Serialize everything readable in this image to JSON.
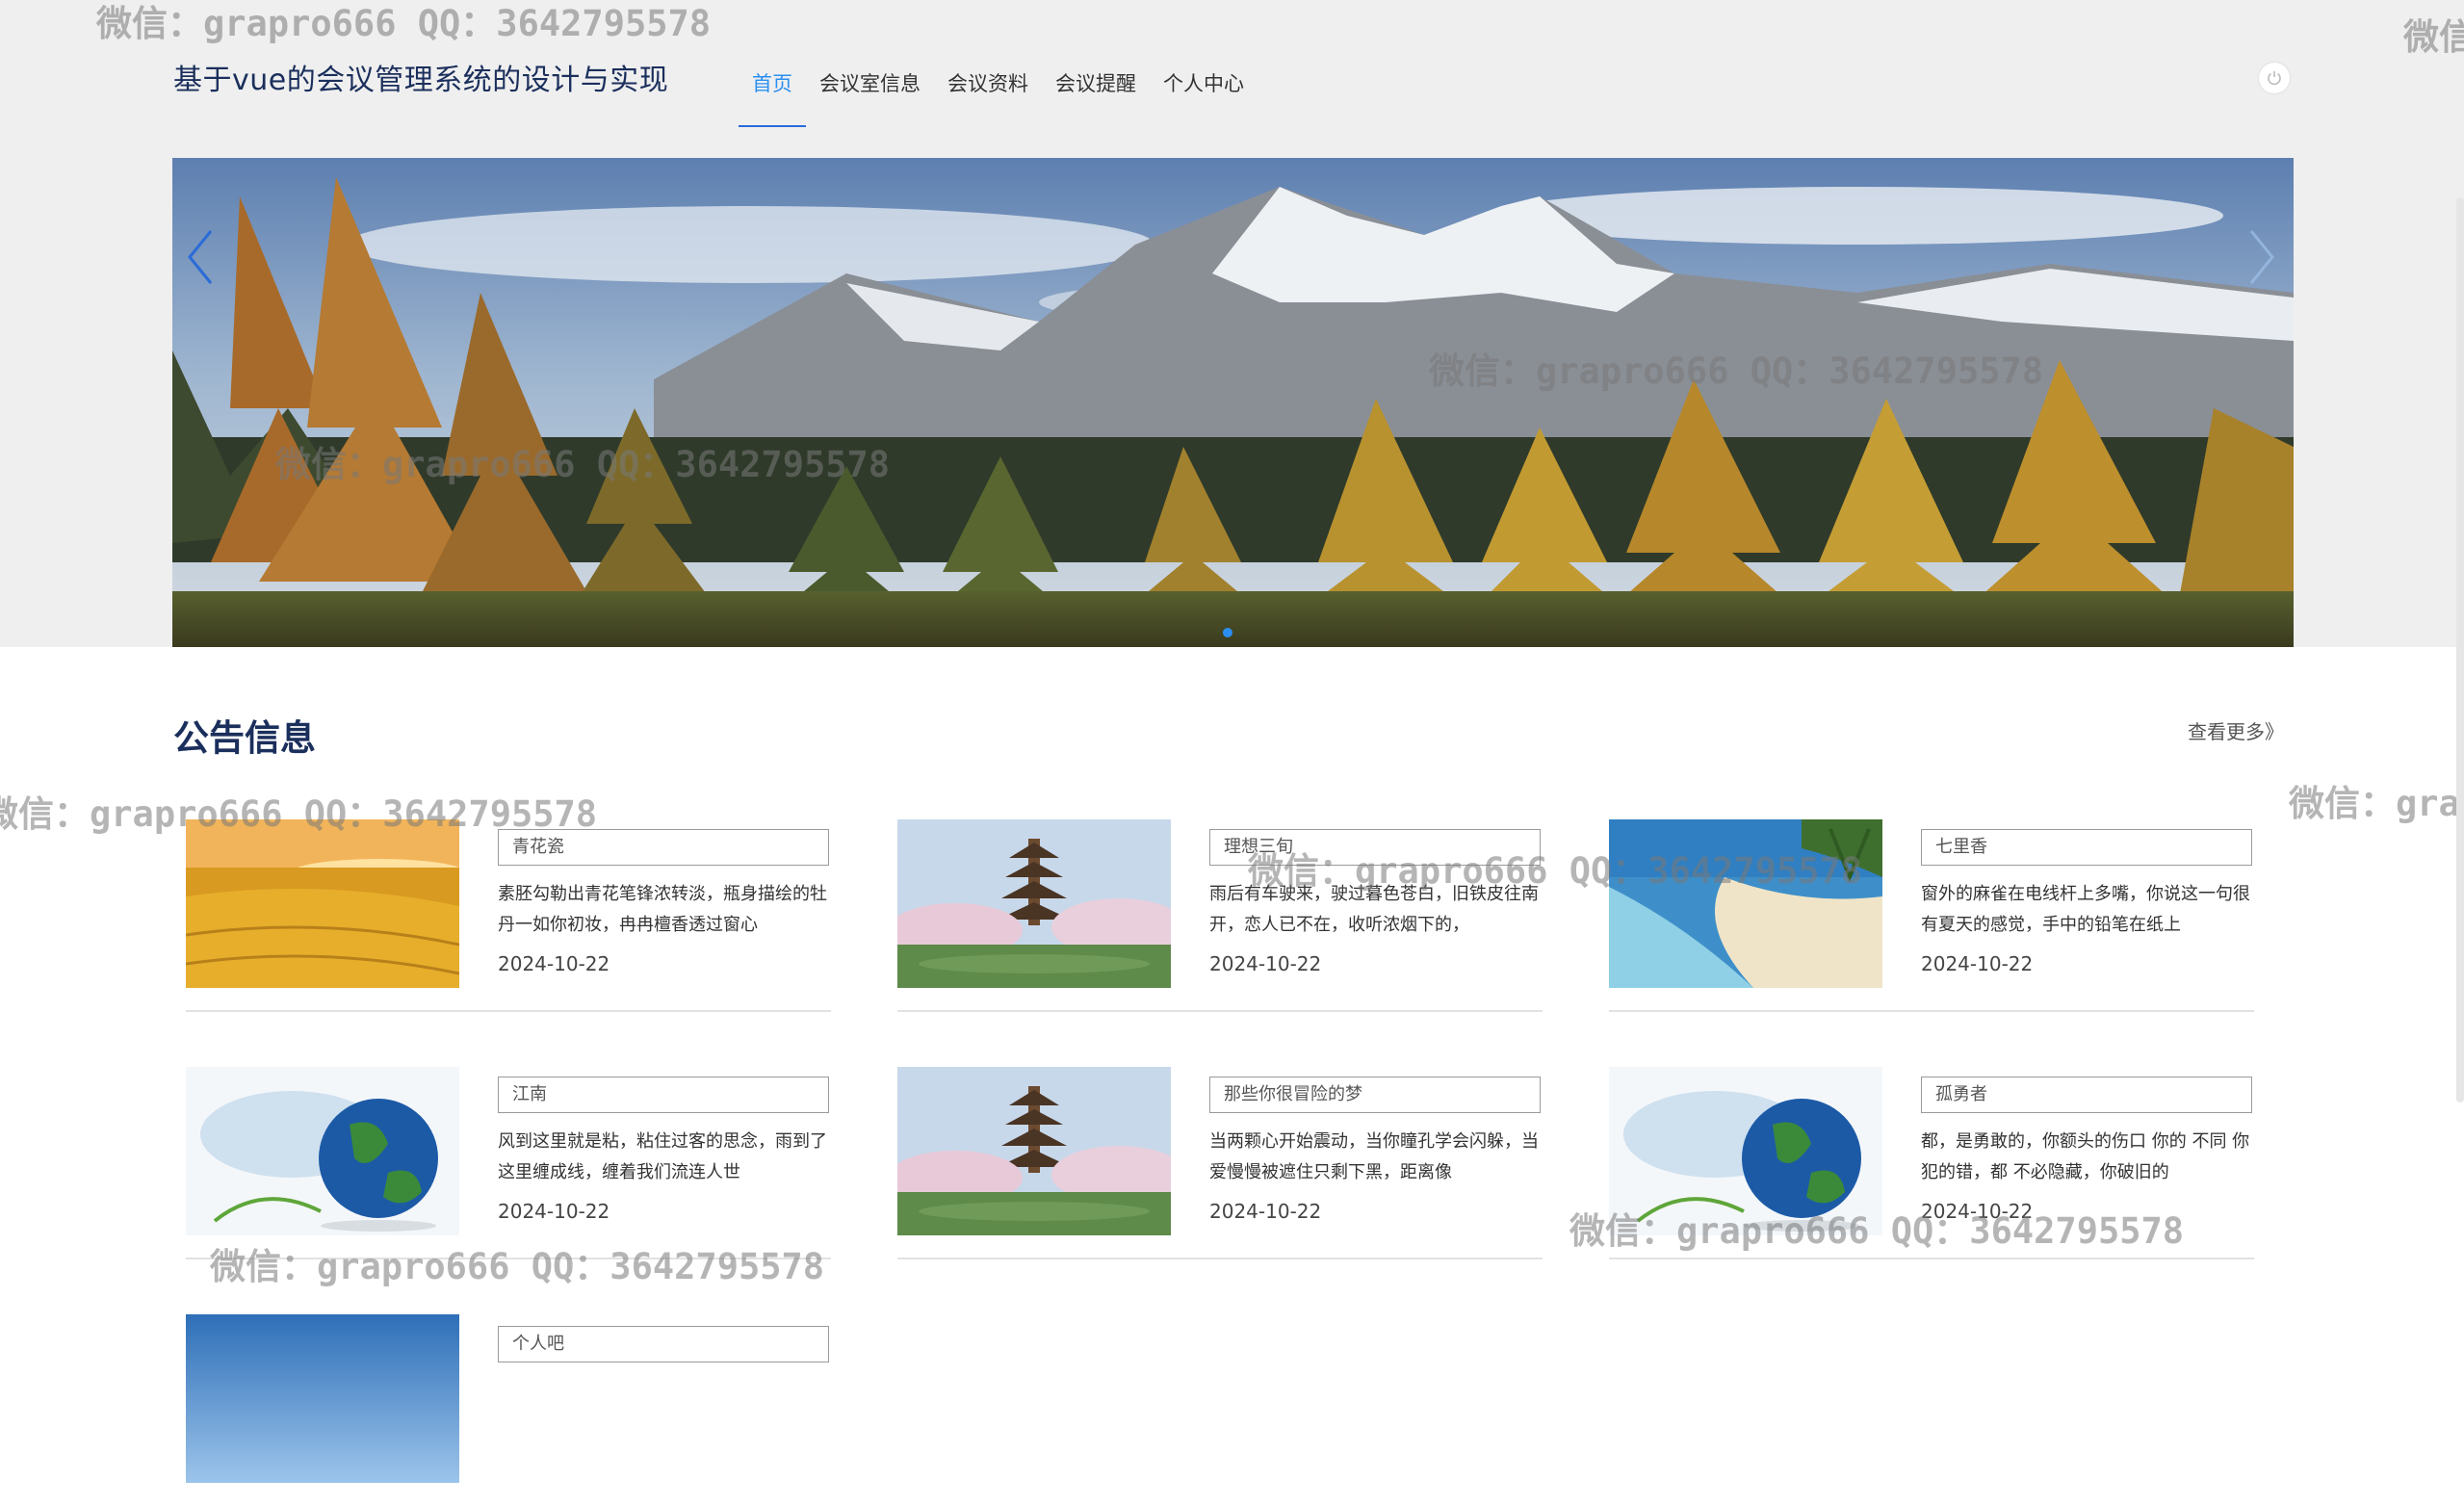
{
  "header": {
    "site_title": "基于vue的会议管理系统的设计与实现",
    "nav": [
      {
        "label": "首页",
        "active": true
      },
      {
        "label": "会议室信息",
        "active": false
      },
      {
        "label": "会议资料",
        "active": false
      },
      {
        "label": "会议提醒",
        "active": false
      },
      {
        "label": "个人中心",
        "active": false
      }
    ],
    "power_icon": "power-icon"
  },
  "banner": {
    "slide_count": 1,
    "active_slide": 1
  },
  "announcements": {
    "title": "公告信息",
    "more_label": "查看更多》",
    "items": [
      {
        "title": "青花瓷",
        "excerpt": "素胚勾勒出青花笔锋浓转淡，瓶身描绘的牡丹一如你初妆，冉冉檀香透过窗心",
        "date": "2024-10-22",
        "image": "wheat-field"
      },
      {
        "title": "理想三旬",
        "excerpt": "雨后有车驶来，驶过暮色苍白，旧铁皮往南开，恋人已不在，收听浓烟下的，",
        "date": "2024-10-22",
        "image": "pagoda"
      },
      {
        "title": "七里香",
        "excerpt": "窗外的麻雀在电线杆上多嘴，你说这一句很有夏天的感觉，手中的铅笔在纸上",
        "date": "2024-10-22",
        "image": "beach"
      },
      {
        "title": "江南",
        "excerpt": "风到这里就是粘，粘住过客的思念，雨到了这里缠成线，缠着我们流连人世",
        "date": "2024-10-22",
        "image": "globe"
      },
      {
        "title": "那些你很冒险的梦",
        "excerpt": "当两颗心开始震动，当你瞳孔学会闪躲，当爱慢慢被遮住只剩下黑，距离像",
        "date": "2024-10-22",
        "image": "pagoda"
      },
      {
        "title": "孤勇者",
        "excerpt": "都，是勇敢的，你额头的伤口 你的 不同 你犯的错，都 不必隐藏，你破旧的",
        "date": "2024-10-22",
        "image": "globe"
      },
      {
        "title": "个人吧",
        "excerpt": "",
        "date": "",
        "image": "sky"
      }
    ]
  },
  "watermark": "微信：grapro666 QQ：3642795578",
  "watermark_short_1": "微信",
  "watermark_short_2": "微信：gra"
}
